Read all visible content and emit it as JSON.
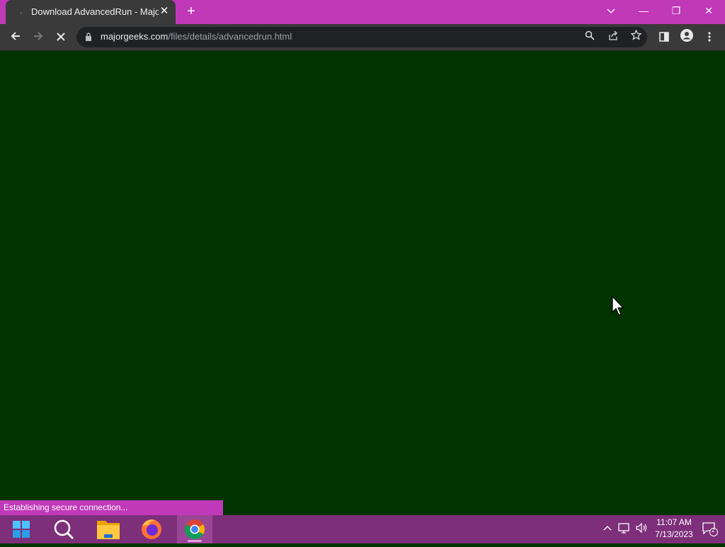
{
  "browser": {
    "tab_title": "Download AdvancedRun - Major",
    "url_host": "majorgeeks.com",
    "url_path": "/files/details/advancedrun.html"
  },
  "window_controls": {
    "minimize": "—",
    "restore": "❐",
    "close": "✕"
  },
  "status_text": "Establishing secure connection...",
  "taskbar": {
    "time": "11:07 AM",
    "date": "7/13/2023",
    "notification_count": "2"
  },
  "colors": {
    "titlebar": "#c039b8",
    "page_background": "#003300",
    "taskbar": "#7d2f7a"
  }
}
